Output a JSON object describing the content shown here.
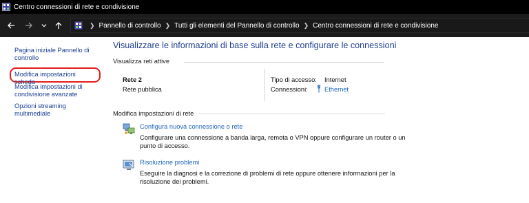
{
  "window": {
    "title": "Centro connessioni di rete e condivisione"
  },
  "address_bar": {
    "breadcrumbs": [
      "Pannello di controllo",
      "Tutti gli elementi del Pannello di controllo",
      "Centro connessioni di rete e condivisione"
    ]
  },
  "sidebar": {
    "items": [
      {
        "label": "Pagina iniziale Pannello di controllo"
      },
      {
        "label": "Modifica impostazioni scheda"
      },
      {
        "label": "Modifica impostazioni di condivisione avanzate"
      },
      {
        "label": "Opzioni streaming multimediale"
      }
    ],
    "highlight_color": "#e41b1b"
  },
  "main": {
    "title": "Visualizzare le informazioni di base sulla rete e configurare le connessioni",
    "active_networks_header": "Visualizza reti attive",
    "network": {
      "name": "Rete 2",
      "type": "Rete pubblica",
      "access_type_label": "Tipo di accesso:",
      "access_type_value": "Internet",
      "connections_label": "Connessioni:",
      "connections_value": "Ethernet"
    },
    "settings_header": "Modifica impostazioni di rete",
    "tasks": [
      {
        "title": "Configura nuova connessione o rete",
        "description": "Configurare una connessione a banda larga, remota o VPN oppure configurare un router o un punto di accesso.",
        "icon": "network-setup-icon"
      },
      {
        "title": "Risoluzione problemi",
        "description": "Eseguire la diagnosi e la correzione di problemi di rete oppure ottenere informazioni per la risoluzione dei problemi.",
        "icon": "troubleshoot-icon"
      }
    ]
  },
  "colors": {
    "link": "#1e63b6",
    "title": "#1e3d8f",
    "sidebar_link": "#1b3d94",
    "titlebar_bg": "#000000",
    "navbar_bg": "#1c1c1c"
  }
}
